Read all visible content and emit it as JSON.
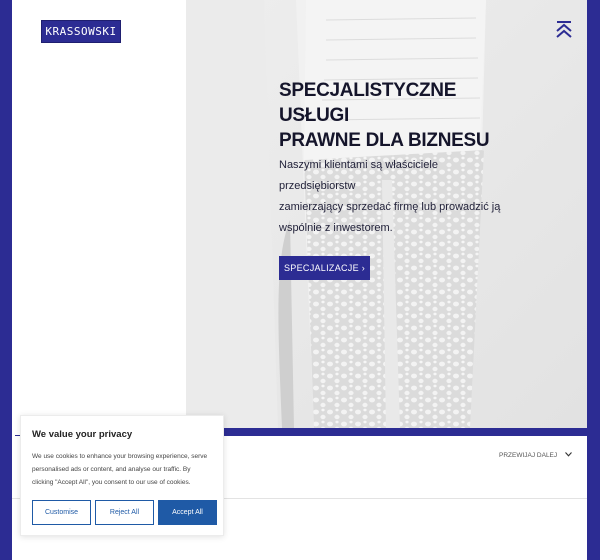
{
  "brand": {
    "logo_text": "KRASSOWSKI"
  },
  "hero": {
    "headline_line1": "SPECJALISTYCZNE USŁUGI",
    "headline_line2": "PRAWNE DLA BIZNESU",
    "lead_line1": "Naszymi klientami są właściciele przedsiębiorstw",
    "lead_line2": "zamierzający sprzedać firmę lub prowadzić ją",
    "lead_line3": "wspólnie z inwestorem.",
    "cta_label": "SPECJALIZACJE ›"
  },
  "scroll": {
    "label": "PRZEWIJAJ DALEJ",
    "icon": "chevron-down-icon"
  },
  "nav": {
    "menu_icon": "menu-collapse-icon"
  },
  "cookie_banner": {
    "title": "We value your privacy",
    "text_line1": "We use cookies to enhance your browsing experience, serve",
    "text_line2": "personalised ads or content, and analyse our traffic. By",
    "text_line3": "clicking \"Accept All\", you consent to our use of cookies.",
    "customise_label": "Customise",
    "reject_label": "Reject All",
    "accept_label": "Accept All"
  },
  "colors": {
    "brand": "#2c2c93",
    "cookie_accent": "#1f5aa6",
    "hero_bg": "#e7e7e7"
  }
}
